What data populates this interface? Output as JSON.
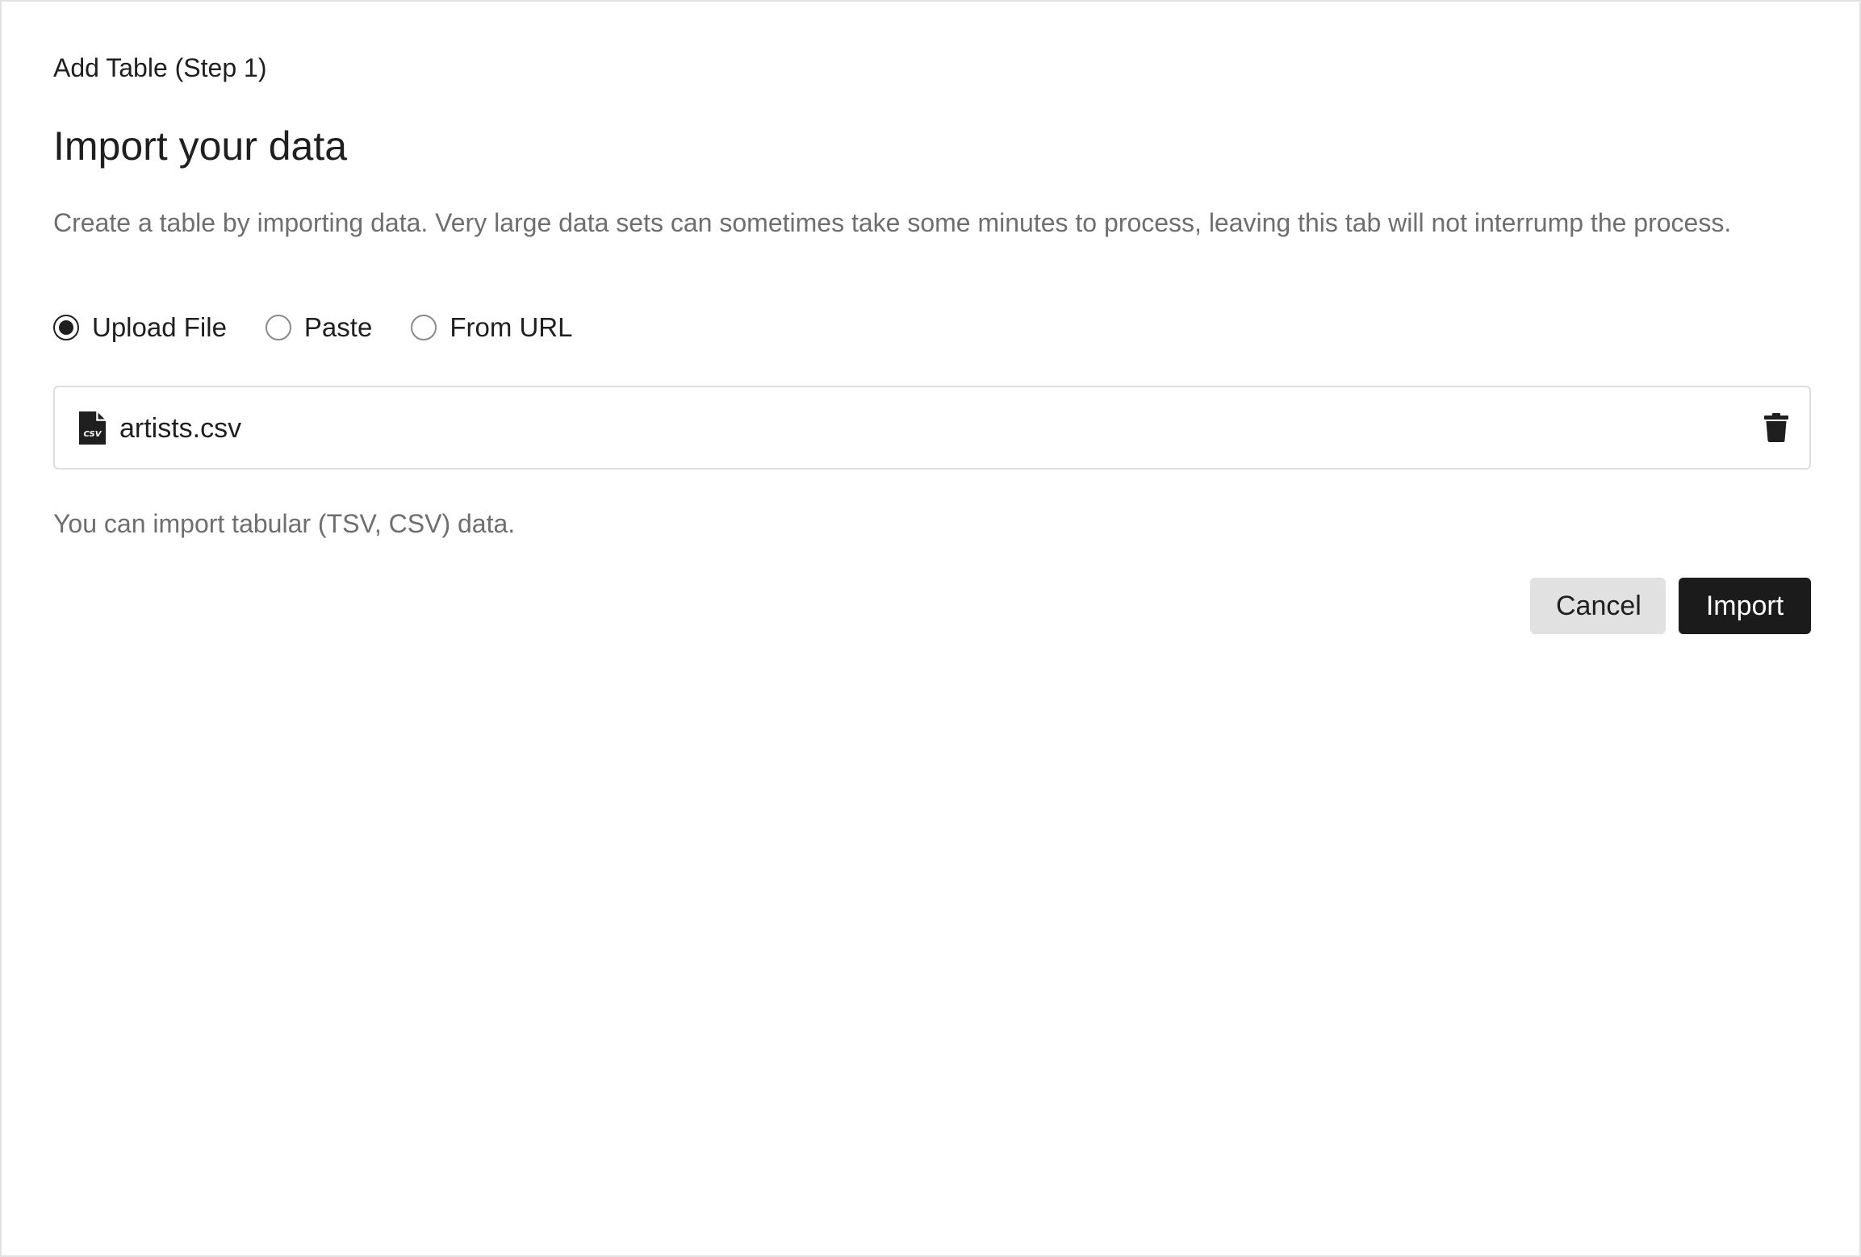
{
  "dialog": {
    "step_title": "Add Table (Step 1)",
    "heading": "Import your data",
    "description": "Create a table by importing data. Very large data sets can sometimes take some minutes to process, leaving this tab will not interrump the process."
  },
  "import_source": {
    "selected": "upload",
    "options": [
      {
        "id": "upload",
        "label": "Upload File",
        "checked": true
      },
      {
        "id": "paste",
        "label": "Paste",
        "checked": false
      },
      {
        "id": "url",
        "label": "From URL",
        "checked": false
      }
    ]
  },
  "file": {
    "name": "artists.csv",
    "icon": "csv-file-icon",
    "icon_badge": "CSV",
    "remove_icon": "trash-icon"
  },
  "hint": "You can import tabular (TSV, CSV) data.",
  "actions": {
    "cancel_label": "Cancel",
    "import_label": "Import"
  },
  "colors": {
    "primary_button": "#1b1b1b",
    "secondary_button": "#e1e1e1",
    "muted_text": "#6e6e6e"
  }
}
